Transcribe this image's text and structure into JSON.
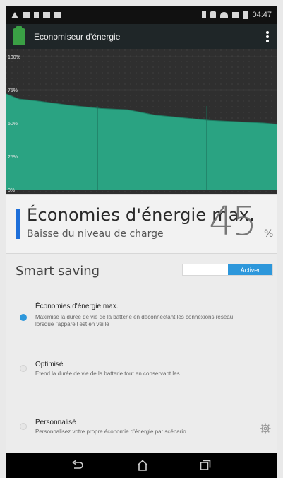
{
  "status_bar": {
    "time": "04:47",
    "left_icons": [
      "warning-icon",
      "image-icon",
      "lock-icon",
      "message-icon",
      "settings-icon"
    ],
    "right_icons": [
      "bluetooth-icon",
      "vibrate-icon",
      "wifi-icon",
      "signal-icon",
      "battery-icon"
    ]
  },
  "app_bar": {
    "title": "Economiseur d'énergie",
    "icon": "battery-icon"
  },
  "chart": {
    "y_ticks": [
      "100%",
      "75%",
      "50%",
      "25%",
      "0%"
    ]
  },
  "chart_data": {
    "type": "area",
    "title": "",
    "xlabel": "",
    "ylabel": "",
    "ylim": [
      0,
      100
    ],
    "y_ticks": [
      100,
      75,
      50,
      25,
      0
    ],
    "x": [
      0,
      5,
      10,
      25,
      35,
      45,
      55,
      65,
      75,
      85,
      95,
      100
    ],
    "values": [
      72,
      68,
      67,
      63,
      61,
      60,
      56,
      54,
      52,
      51,
      50,
      49
    ],
    "grid": true,
    "colors": {
      "fill": "#2aa382",
      "line": "#1f7c63",
      "background": "#2f2f2f"
    }
  },
  "energy": {
    "title": "Économies d'énergie max.",
    "subtitle": "Baisse du niveau de charge",
    "percent": "45",
    "percent_sign": "%"
  },
  "smart_saving": {
    "title": "Smart saving",
    "toggle_label": "Activer",
    "accent_color": "#2d97db"
  },
  "options": [
    {
      "title": "Économies d'énergie max.",
      "desc": "Maximise la durée de vie de la batterie en déconnectant les connexions réseau lorsque l'appareil est en veille",
      "selected": true
    },
    {
      "title": "Optimisé",
      "desc": "Etend la durée de vie de la batterie tout en conservant les...",
      "selected": false
    },
    {
      "title": "Personnalisé",
      "desc": "Personnalisez votre propre économie d'énergie par scénario",
      "selected": false,
      "has_settings": true
    }
  ],
  "nav_bar": {
    "buttons": [
      "back-icon",
      "home-icon",
      "recents-icon"
    ]
  }
}
